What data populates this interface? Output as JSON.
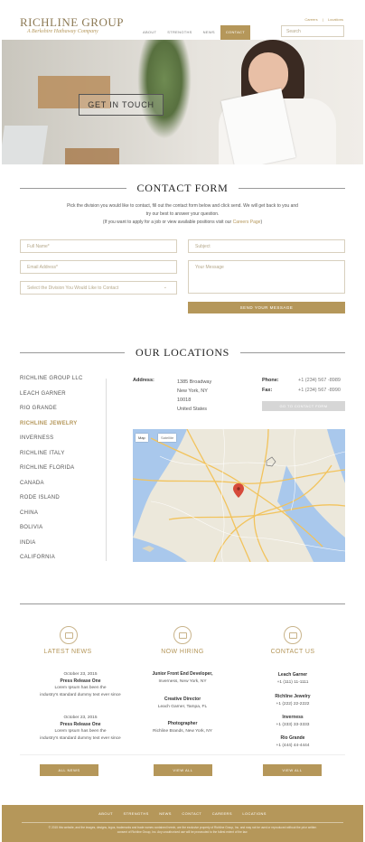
{
  "brand": {
    "name": "RICHLINE GROUP",
    "tagline": "A Berkshire Hathaway Company",
    "color_gold": "#b5975a"
  },
  "toplinks": [
    "Careers",
    "|",
    "Locations"
  ],
  "nav": {
    "items": [
      "ABOUT",
      "STRENGTHS",
      "NEWS",
      "CONTACT"
    ],
    "active": "CONTACT"
  },
  "search": {
    "placeholder": "Search"
  },
  "hero": {
    "button": "GET IN TOUCH"
  },
  "contact": {
    "title": "CONTACT FORM",
    "intro_1": "Pick the division you would like to contact, fill out the contact form below and click send. We will get back to you and",
    "intro_2": "try our best to answer your question.",
    "intro_3_pre": "(If you want to apply for a job or view available positions visit our ",
    "intro_3_link": "Careers Page",
    "intro_3_post": ")",
    "fields": {
      "full_name": "Full Name*",
      "email": "Email Address*",
      "division": "Select the Division You Would Like to Contact",
      "subject": "Subject",
      "message": "Your Message"
    },
    "send_button": "SEND YOUR MESSAGE"
  },
  "locations": {
    "title": "OUR LOCATIONS",
    "list": [
      "RICHLINE GROUP LLC",
      "LEACH GARNER",
      "RIO GRANDE",
      "RICHLINE JEWELRY",
      "INVERNESS",
      "RICHLINE ITALY",
      "RICHLINE FLORIDA",
      "CANADA",
      "RODE ISLAND",
      "CHINA",
      "BOLIVIA",
      "INDIA",
      "CALIFORNIA"
    ],
    "active": "RICHLINE JEWELRY",
    "address_label": "Address:",
    "address_lines": [
      "1385 Broadway",
      "New York, NY",
      "10018",
      "United States"
    ],
    "phone_label": "Phone:",
    "phone": "+1 (234) 567 -8989",
    "fax_label": "Fax:",
    "fax": "+1 (234) 567 -8990",
    "contact_button": "GO TO CONTACT FORM",
    "map_tabs": [
      "Map",
      "Satellite"
    ]
  },
  "news": {
    "title": "LATEST NEWS",
    "items": [
      {
        "date": "October 23, 2015",
        "title": "Press Release One",
        "text_1": "Lorem Ipsum has been the",
        "text_2": "industry's standard dummy text ever since"
      },
      {
        "date": "October 23, 2015",
        "title": "Press Release One",
        "text_1": "Lorem Ipsum has been the",
        "text_2": "industry's standard dummy text ever since"
      }
    ],
    "button": "ALL NEWS"
  },
  "hiring": {
    "title": "NOW HIRING",
    "items": [
      {
        "role": "Junior Front End Developer,",
        "place": "Inverness, New York, NY"
      },
      {
        "role": "Creative Director",
        "place": "Leach Garner, Tampa, FL"
      },
      {
        "role": "Photographer",
        "place": "Richline Brands, New York, NY"
      }
    ],
    "button": "VIEW ALL"
  },
  "contacts": {
    "title": "CONTACT US",
    "items": [
      {
        "name": "Leach Garner",
        "phone": "+1 (111) 11-1111"
      },
      {
        "name": "Richline Jewelry",
        "phone": "+1 (222) 22-2222"
      },
      {
        "name": "Inverness",
        "phone": "+1 (333) 33-3333"
      },
      {
        "name": "Rio Grande",
        "phone": "+1 (444) 44-4444"
      }
    ],
    "button": "VIEW ALL"
  },
  "footer": {
    "nav": [
      "ABOUT",
      "STRENGTHS",
      "NEWS",
      "CONTACT",
      "CAREERS",
      "LOCATIONS"
    ],
    "legal_1": "© 2015 this website, and the images, designs, logos, trademarks and trade names contained herein, are the exclusive property of Richline Group, Inc. and may not be used or reproduced without the prior written",
    "legal_2": "consent of Richline Group, Inc. Any unauthorized use will be prosecuted to the fullest extent of the law."
  }
}
